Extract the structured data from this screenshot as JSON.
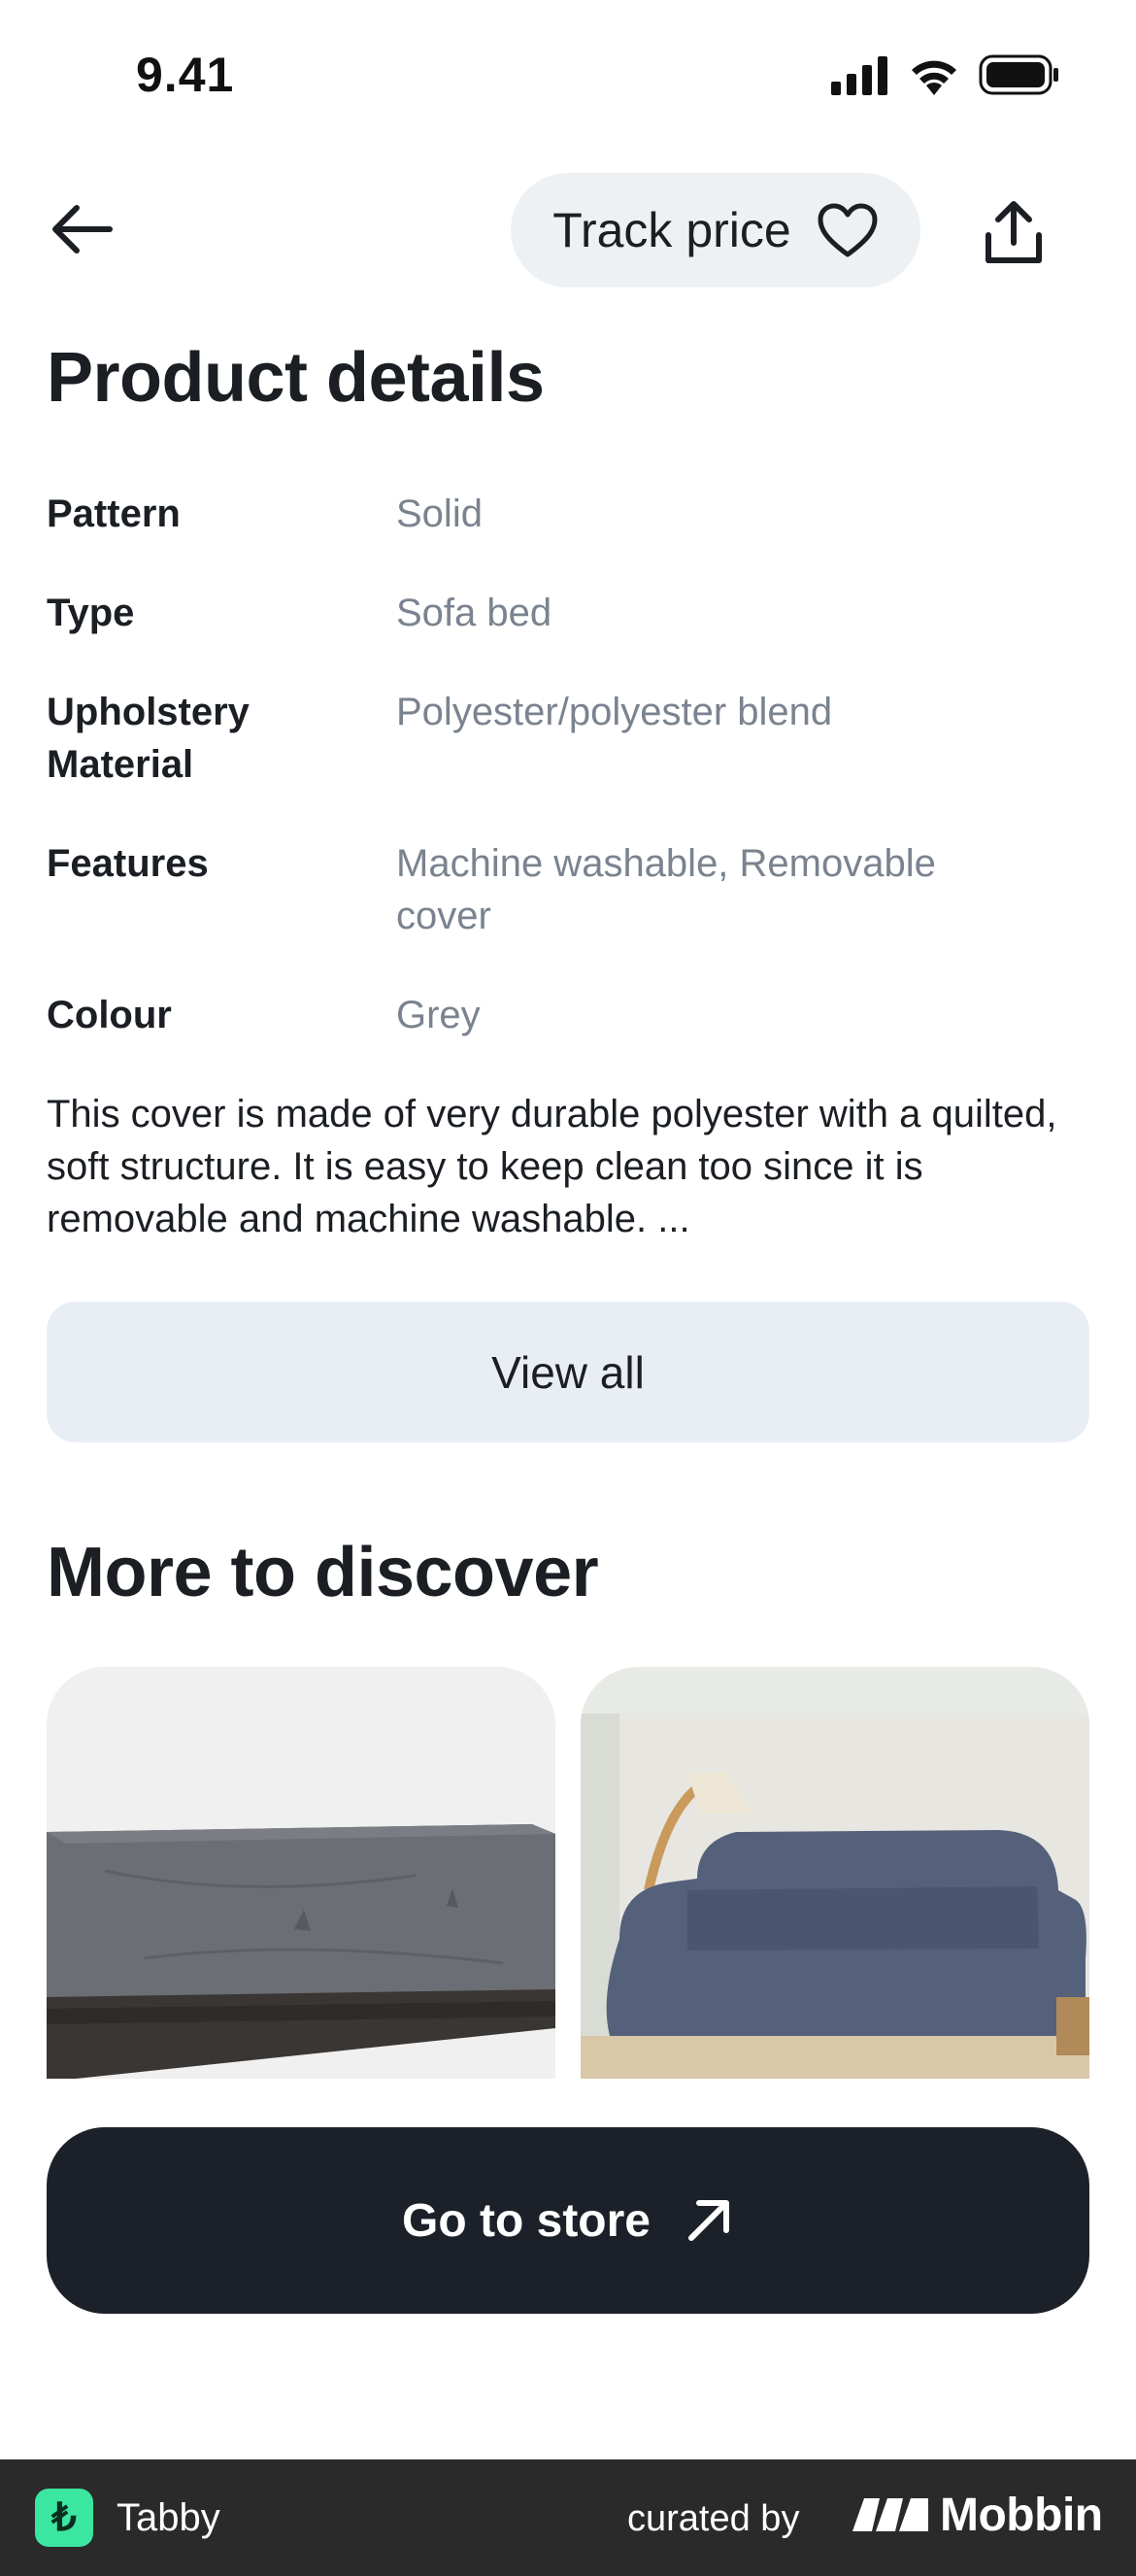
{
  "status_bar": {
    "time": "9.41"
  },
  "header": {
    "track_price_label": "Track price"
  },
  "product_details": {
    "title": "Product details",
    "rows": [
      {
        "label": "Pattern",
        "value": "Solid"
      },
      {
        "label": "Type",
        "value": "Sofa bed"
      },
      {
        "label": "Upholstery Material",
        "value": "Polyester/polyester blend"
      },
      {
        "label": "Features",
        "value": "Machine washable, Removable cover"
      },
      {
        "label": "Colour",
        "value": "Grey"
      }
    ],
    "description": "This cover is made of very durable polyester with a quilted, soft structure. It is easy to keep clean too since it is removable and machine washable. ...",
    "view_all_label": "View all"
  },
  "discover": {
    "title": "More to discover",
    "cards": [
      {
        "image_icon": "patio-furniture-cover-image"
      },
      {
        "image_icon": "sofa-cover-image"
      }
    ]
  },
  "cta": {
    "go_to_store_label": "Go to store"
  },
  "footer": {
    "app_name": "Tabby",
    "app_logo_glyph": "₺",
    "curated_label": "curated by",
    "brand_name": "Mobbin"
  },
  "colors": {
    "primary_dark": "#1c2129",
    "muted_text": "#7a838f",
    "button_bg": "#e9eef5",
    "tabby_green": "#3be6a0"
  }
}
